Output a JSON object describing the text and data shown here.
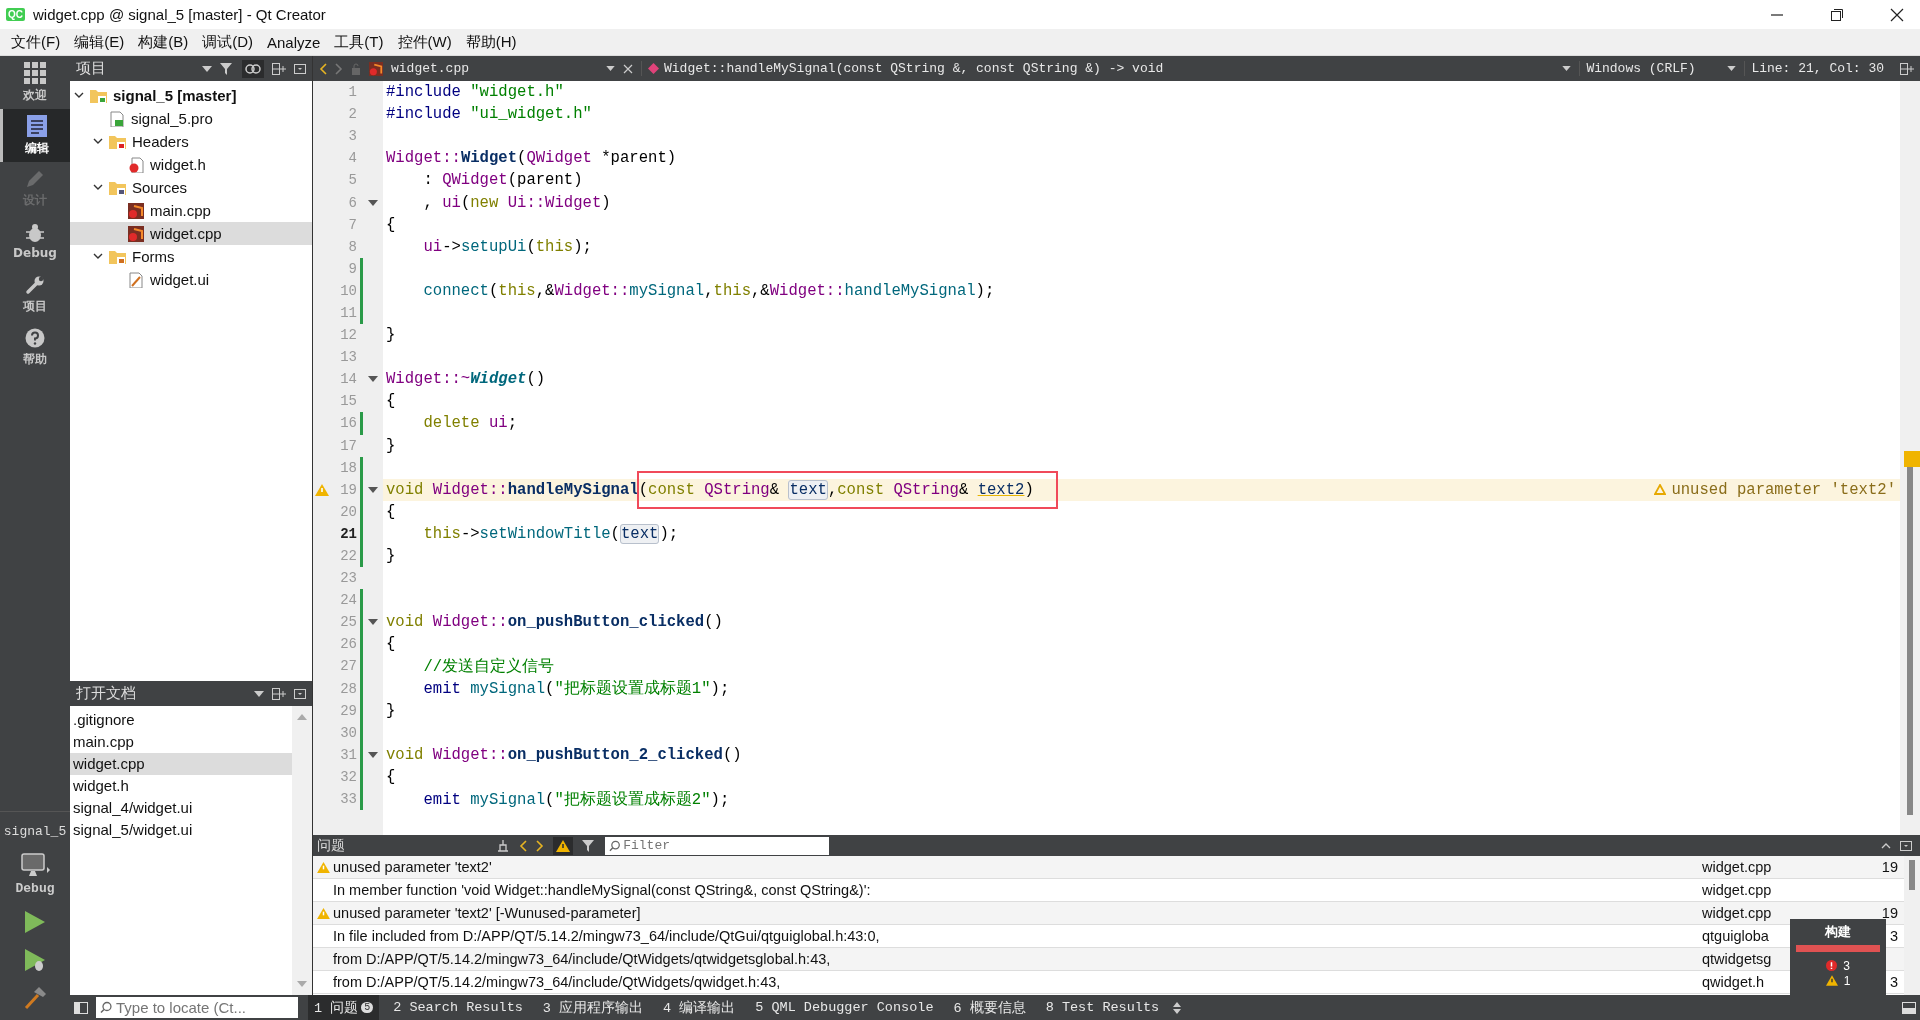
{
  "window": {
    "logo": "QC",
    "title": "widget.cpp @ signal_5 [master] - Qt Creator"
  },
  "menu": [
    "文件(F)",
    "编辑(E)",
    "构建(B)",
    "调试(D)",
    "Analyze",
    "工具(T)",
    "控件(W)",
    "帮助(H)"
  ],
  "modes": [
    {
      "label": "欢迎",
      "kind": "welcome",
      "selected": false,
      "disabled": false
    },
    {
      "label": "编辑",
      "kind": "edit",
      "selected": true,
      "disabled": false
    },
    {
      "label": "设计",
      "kind": "design",
      "selected": false,
      "disabled": true
    },
    {
      "label": "Debug",
      "kind": "debug",
      "selected": false,
      "disabled": false
    },
    {
      "label": "项目",
      "kind": "projects",
      "selected": false,
      "disabled": false
    },
    {
      "label": "帮助",
      "kind": "help",
      "selected": false,
      "disabled": false
    }
  ],
  "target": {
    "project": "signal_5",
    "config": "Debug"
  },
  "projects_panel": {
    "title": "项目",
    "tree": [
      {
        "label": "signal_5 [master]",
        "kind": "project",
        "expanded": true,
        "selected": false,
        "children": [
          {
            "label": "signal_5.pro",
            "kind": "pro",
            "selected": false
          },
          {
            "label": "Headers",
            "kind": "folder-headers",
            "expanded": true,
            "selected": false,
            "children": [
              {
                "label": "widget.h",
                "kind": "header",
                "selected": false
              }
            ]
          },
          {
            "label": "Sources",
            "kind": "folder-sources",
            "expanded": true,
            "selected": false,
            "children": [
              {
                "label": "main.cpp",
                "kind": "source",
                "selected": false
              },
              {
                "label": "widget.cpp",
                "kind": "source",
                "selected": true
              }
            ]
          },
          {
            "label": "Forms",
            "kind": "folder-forms",
            "expanded": true,
            "selected": false,
            "children": [
              {
                "label": "widget.ui",
                "kind": "form",
                "selected": false
              }
            ]
          }
        ]
      }
    ]
  },
  "open_documents": {
    "title": "打开文档",
    "items": [
      {
        "label": ".gitignore",
        "selected": false
      },
      {
        "label": "main.cpp",
        "selected": false
      },
      {
        "label": "widget.cpp",
        "selected": true
      },
      {
        "label": "widget.h",
        "selected": false
      },
      {
        "label": "signal_4/widget.ui",
        "selected": false
      },
      {
        "label": "signal_5/widget.ui",
        "selected": false
      }
    ]
  },
  "editor": {
    "file": "widget.cpp",
    "symbol": "Widget::handleMySignal(const QString &, const QString &) -> void",
    "line_ending": "Windows (CRLF)",
    "position": "Line: 21, Col: 30",
    "lines": [
      {
        "number": "1",
        "fold": false,
        "modified": false,
        "warning": false,
        "current": false,
        "tokens": [
          {
            "kind": "pp",
            "text": "#include "
          },
          {
            "kind": "str",
            "text": "\"widget.h\""
          }
        ]
      },
      {
        "number": "2",
        "fold": false,
        "modified": false,
        "warning": false,
        "current": false,
        "tokens": [
          {
            "kind": "pp",
            "text": "#include "
          },
          {
            "kind": "str",
            "text": "\"ui_widget.h\""
          }
        ]
      },
      {
        "number": "3",
        "fold": false,
        "modified": false,
        "warning": false,
        "current": false
      },
      {
        "number": "4",
        "fold": false,
        "modified": false,
        "warning": false,
        "current": false,
        "tokens": [
          {
            "kind": "type",
            "text": "Widget::"
          },
          {
            "kind": "decl",
            "text": "Widget"
          },
          {
            "kind": "pl",
            "text": "("
          },
          {
            "kind": "type",
            "text": "QWidget"
          },
          {
            "kind": "pl",
            "text": " *parent)"
          }
        ]
      },
      {
        "number": "5",
        "fold": false,
        "modified": false,
        "warning": false,
        "current": false,
        "tokens": [
          {
            "kind": "pl",
            "text": "    : "
          },
          {
            "kind": "type",
            "text": "QWidget"
          },
          {
            "kind": "pl",
            "text": "(parent)"
          }
        ]
      },
      {
        "number": "6",
        "fold": true,
        "modified": false,
        "warning": false,
        "current": false,
        "tokens": [
          {
            "kind": "pl",
            "text": "    , "
          },
          {
            "kind": "type",
            "text": "ui"
          },
          {
            "kind": "pl",
            "text": "("
          },
          {
            "kind": "kw",
            "text": "new "
          },
          {
            "kind": "type",
            "text": "Ui::Widget"
          },
          {
            "kind": "pl",
            "text": ")"
          }
        ]
      },
      {
        "number": "7",
        "fold": false,
        "modified": false,
        "warning": false,
        "current": false,
        "tokens": [
          {
            "kind": "pl",
            "text": "{"
          }
        ]
      },
      {
        "number": "8",
        "fold": false,
        "modified": false,
        "warning": false,
        "current": false,
        "tokens": [
          {
            "kind": "type",
            "text": "    ui"
          },
          {
            "kind": "pl",
            "text": "->"
          },
          {
            "kind": "fn",
            "text": "setupUi"
          },
          {
            "kind": "pl",
            "text": "("
          },
          {
            "kind": "kw",
            "text": "this"
          },
          {
            "kind": "pl",
            "text": ");"
          }
        ]
      },
      {
        "number": "9",
        "fold": false,
        "modified": true,
        "warning": false,
        "current": false
      },
      {
        "number": "10",
        "fold": false,
        "modified": true,
        "warning": false,
        "current": false,
        "tokens": [
          {
            "kind": "fn",
            "text": "    connect"
          },
          {
            "kind": "pl",
            "text": "("
          },
          {
            "kind": "kw",
            "text": "this"
          },
          {
            "kind": "pl",
            "text": ",&"
          },
          {
            "kind": "type",
            "text": "Widget::"
          },
          {
            "kind": "fn",
            "text": "mySignal"
          },
          {
            "kind": "pl",
            "text": ","
          },
          {
            "kind": "kw",
            "text": "this"
          },
          {
            "kind": "pl",
            "text": ",&"
          },
          {
            "kind": "type",
            "text": "Widget::"
          },
          {
            "kind": "fn",
            "text": "handleMySignal"
          },
          {
            "kind": "pl",
            "text": ");"
          }
        ]
      },
      {
        "number": "11",
        "fold": false,
        "modified": true,
        "warning": false,
        "current": false
      },
      {
        "number": "12",
        "fold": false,
        "modified": false,
        "warning": false,
        "current": false,
        "tokens": [
          {
            "kind": "pl",
            "text": "}"
          }
        ]
      },
      {
        "number": "13",
        "fold": false,
        "modified": false,
        "warning": false,
        "current": false
      },
      {
        "number": "14",
        "fold": true,
        "modified": false,
        "warning": false,
        "current": false,
        "tokens": [
          {
            "kind": "type",
            "text": "Widget::~"
          },
          {
            "kind": "dtor",
            "text": "Widget"
          },
          {
            "kind": "pl",
            "text": "()"
          }
        ]
      },
      {
        "number": "15",
        "fold": false,
        "modified": false,
        "warning": false,
        "current": false,
        "tokens": [
          {
            "kind": "pl",
            "text": "{"
          }
        ]
      },
      {
        "number": "16",
        "fold": false,
        "modified": true,
        "warning": false,
        "current": false,
        "tokens": [
          {
            "kind": "kw",
            "text": "    delete "
          },
          {
            "kind": "type",
            "text": "ui"
          },
          {
            "kind": "pl",
            "text": ";"
          }
        ]
      },
      {
        "number": "17",
        "fold": false,
        "modified": false,
        "warning": false,
        "current": false,
        "tokens": [
          {
            "kind": "pl",
            "text": "}"
          }
        ]
      },
      {
        "number": "18",
        "fold": false,
        "modified": true,
        "warning": false,
        "current": false
      },
      {
        "number": "19",
        "fold": true,
        "modified": true,
        "warning": true,
        "current": false,
        "annotation": "unused parameter 'text2'",
        "tokens": [
          {
            "kind": "kw",
            "text": "void "
          },
          {
            "kind": "type",
            "text": "Widget::"
          },
          {
            "kind": "decl",
            "text": "handleMySignal"
          }
        ],
        "boxed_tokens": [
          {
            "kind": "pl",
            "text": "("
          },
          {
            "kind": "kw",
            "text": "const "
          },
          {
            "kind": "type",
            "text": "QString"
          },
          {
            "kind": "pl",
            "text": "& "
          },
          {
            "kind": "ref",
            "text": "text"
          },
          {
            "kind": "pl",
            "text": ","
          },
          {
            "kind": "kw",
            "text": "const "
          },
          {
            "kind": "type",
            "text": "QString"
          },
          {
            "kind": "pl",
            "text": "& "
          },
          {
            "kind": "warnref",
            "text": "text2"
          },
          {
            "kind": "pl",
            "text": ")"
          }
        ]
      },
      {
        "number": "20",
        "fold": false,
        "modified": true,
        "warning": false,
        "current": false,
        "tokens": [
          {
            "kind": "pl",
            "text": "{"
          }
        ]
      },
      {
        "number": "21",
        "fold": false,
        "modified": true,
        "warning": false,
        "current": true,
        "tokens": [
          {
            "kind": "kw",
            "text": "    this"
          },
          {
            "kind": "pl",
            "text": "->"
          },
          {
            "kind": "fn",
            "text": "setWindowTitle"
          },
          {
            "kind": "pl",
            "text": "("
          },
          {
            "kind": "ref",
            "text": "text"
          },
          {
            "kind": "pl",
            "text": ");"
          }
        ]
      },
      {
        "number": "22",
        "fold": false,
        "modified": true,
        "warning": false,
        "current": false,
        "tokens": [
          {
            "kind": "pl",
            "text": "}"
          }
        ]
      },
      {
        "number": "23",
        "fold": false,
        "modified": false,
        "warning": false,
        "current": false
      },
      {
        "number": "24",
        "fold": false,
        "modified": true,
        "warning": false,
        "current": false
      },
      {
        "number": "25",
        "fold": true,
        "modified": true,
        "warning": false,
        "current": false,
        "tokens": [
          {
            "kind": "kw",
            "text": "void "
          },
          {
            "kind": "type",
            "text": "Widget::"
          },
          {
            "kind": "decl",
            "text": "on_pushButton_clicked"
          },
          {
            "kind": "pl",
            "text": "()"
          }
        ]
      },
      {
        "number": "26",
        "fold": false,
        "modified": true,
        "warning": false,
        "current": false,
        "tokens": [
          {
            "kind": "pl",
            "text": "{"
          }
        ]
      },
      {
        "number": "27",
        "fold": false,
        "modified": true,
        "warning": false,
        "current": false,
        "tokens": [
          {
            "kind": "cm",
            "text": "    //发送自定义信号"
          }
        ]
      },
      {
        "number": "28",
        "fold": false,
        "modified": true,
        "warning": false,
        "current": false,
        "tokens": [
          {
            "kind": "pp",
            "text": "    emit "
          },
          {
            "kind": "fn",
            "text": "mySignal"
          },
          {
            "kind": "pl",
            "text": "("
          },
          {
            "kind": "str",
            "text": "\"把标题设置成标题1\""
          },
          {
            "kind": "pl",
            "text": ");"
          }
        ]
      },
      {
        "number": "29",
        "fold": false,
        "modified": true,
        "warning": false,
        "current": false,
        "tokens": [
          {
            "kind": "pl",
            "text": "}"
          }
        ]
      },
      {
        "number": "30",
        "fold": false,
        "modified": true,
        "warning": false,
        "current": false
      },
      {
        "number": "31",
        "fold": true,
        "modified": true,
        "warning": false,
        "current": false,
        "tokens": [
          {
            "kind": "kw",
            "text": "void "
          },
          {
            "kind": "type",
            "text": "Widget::"
          },
          {
            "kind": "decl",
            "text": "on_pushButton_2_clicked"
          },
          {
            "kind": "pl",
            "text": "()"
          }
        ]
      },
      {
        "number": "32",
        "fold": false,
        "modified": true,
        "warning": false,
        "current": false,
        "tokens": [
          {
            "kind": "pl",
            "text": "{"
          }
        ]
      },
      {
        "number": "33",
        "fold": false,
        "modified": true,
        "warning": false,
        "current": false,
        "tokens": [
          {
            "kind": "pp",
            "text": "    emit "
          },
          {
            "kind": "fn",
            "text": "mySignal"
          },
          {
            "kind": "pl",
            "text": "("
          },
          {
            "kind": "str",
            "text": "\"把标题设置成标题2\""
          },
          {
            "kind": "pl",
            "text": ");"
          }
        ]
      }
    ]
  },
  "issues": {
    "title": "问题",
    "filter_placeholder": "Filter",
    "rows": [
      {
        "kind": "warning",
        "text": "unused parameter 'text2'",
        "file": "widget.cpp",
        "line": "19"
      },
      {
        "kind": "info",
        "text": "In member function 'void Widget::handleMySignal(const QString&, const QString&)':",
        "file": "widget.cpp"
      },
      {
        "kind": "warning",
        "text": "unused parameter 'text2' [-Wunused-parameter]",
        "file": "widget.cpp",
        "line": "19"
      },
      {
        "kind": "info",
        "text": "In file included from D:/APP/QT/5.14.2/mingw73_64/include/QtGui/qtguiglobal.h:43:0,",
        "file": "qtguigloba",
        "line": "3"
      },
      {
        "kind": "info",
        "text": "from D:/APP/QT/5.14.2/mingw73_64/include/QtWidgets/qtwidgetsglobal.h:43,",
        "file": "qtwidgetsg"
      },
      {
        "kind": "info",
        "text": "from D:/APP/QT/5.14.2/mingw73_64/include/QtWidgets/qwidget.h:43,",
        "file": "qwidget.h",
        "line": "3"
      }
    ]
  },
  "build_popup": {
    "title": "构建",
    "level": 1,
    "errors": "3",
    "warnings": "1"
  },
  "locator": {
    "placeholder": "Type to locate (Ct..."
  },
  "output_tabs": [
    {
      "label": "1 问题",
      "badge": "5",
      "selected": true
    },
    {
      "label": "2 Search Results",
      "selected": false
    },
    {
      "label": "3 应用程序输出",
      "selected": false
    },
    {
      "label": "4 编译输出",
      "selected": false
    },
    {
      "label": "5 QML Debugger Console",
      "selected": false
    },
    {
      "label": "6 概要信息",
      "selected": false
    },
    {
      "label": "8 Test Results",
      "selected": false
    }
  ]
}
